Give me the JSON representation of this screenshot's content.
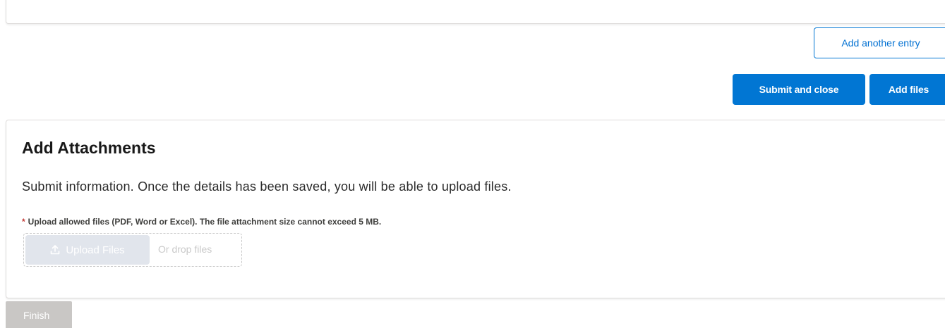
{
  "actions": {
    "add_another_entry_label": "Add another entry",
    "submit_and_close_label": "Submit and close",
    "add_files_label": "Add files"
  },
  "attachments": {
    "title": "Add Attachments",
    "description": "Submit information. Once the details has been saved, you will be able to upload files.",
    "required_marker": "*",
    "requirement_text": "Upload allowed files (PDF, Word or Excel). The file attachment size cannot exceed 5 MB.",
    "upload_button_label": "Upload Files",
    "upload_icon": "upload-icon",
    "drop_text": "Or drop files"
  },
  "footer": {
    "finish_label": "Finish"
  },
  "colors": {
    "brand": "#0176d3",
    "disabled": "#c9c7c5",
    "required": "#c23934"
  }
}
